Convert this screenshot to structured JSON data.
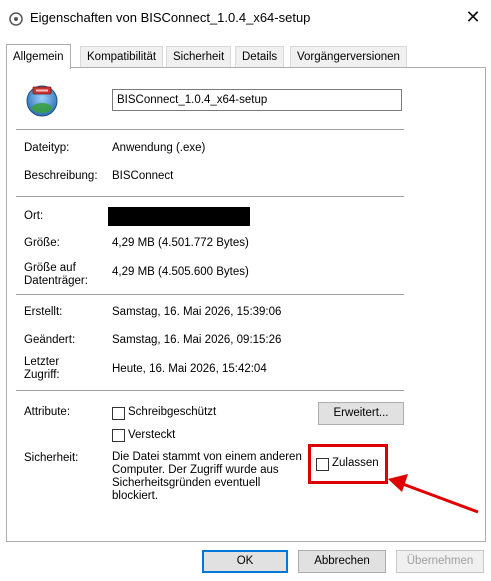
{
  "window": {
    "title": "Eigenschaften von BISConnect_1.0.4_x64-setup",
    "close_glyph": "✕"
  },
  "tabs": [
    "Allgemein",
    "Kompatibilität",
    "Sicherheit",
    "Details",
    "Vorgängerversionen"
  ],
  "general": {
    "filename": "BISConnect_1.0.4_x64-setup",
    "dateityp_label": "Dateityp:",
    "dateityp_value": "Anwendung (.exe)",
    "beschreibung_label": "Beschreibung:",
    "beschreibung_value": "BISConnect",
    "ort_label": "Ort:",
    "groesse_label": "Größe:",
    "groesse_value": "4,29 MB (4.501.772 Bytes)",
    "groesse_disk_label_1": "Größe auf",
    "groesse_disk_label_2": "Datenträger:",
    "groesse_disk_value": "4,29 MB (4.505.600 Bytes)",
    "erstellt_label": "Erstellt:",
    "erstellt_value": "Samstag, 16. Mai 2026, 15:39:06",
    "geaendert_label": "Geändert:",
    "geaendert_value": "Samstag, 16. Mai 2026, 09:15:26",
    "zugriff_label_1": "Letzter",
    "zugriff_label_2": "Zugriff:",
    "zugriff_value": "Heute, 16. Mai 2026, 15:42:04",
    "attribute_label": "Attribute:",
    "schreibgeschuetzt": "Schreibgeschützt",
    "versteckt": "Versteckt",
    "erweitert_button": "Erweitert...",
    "sicherheit_label": "Sicherheit:",
    "sicherheit_text_1": "Die Datei stammt von einem anderen",
    "sicherheit_text_2": "Computer. Der Zugriff wurde aus",
    "sicherheit_text_3": "Sicherheitsgründen eventuell",
    "sicherheit_text_4": "blockiert.",
    "zulassen": "Zulassen"
  },
  "buttons": {
    "ok": "OK",
    "abbrechen": "Abbrechen",
    "uebernehmen": "Übernehmen"
  },
  "colors": {
    "highlight": "#e00000",
    "accent": "#0078d7"
  }
}
